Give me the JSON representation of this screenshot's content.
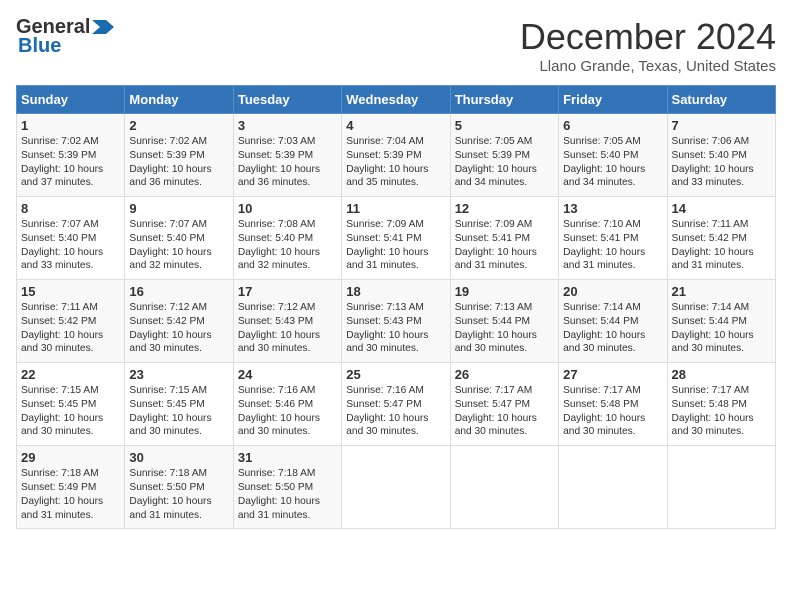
{
  "logo": {
    "part1": "General",
    "part2": "Blue"
  },
  "title": "December 2024",
  "location": "Llano Grande, Texas, United States",
  "days_of_week": [
    "Sunday",
    "Monday",
    "Tuesday",
    "Wednesday",
    "Thursday",
    "Friday",
    "Saturday"
  ],
  "weeks": [
    [
      {
        "day": "1",
        "lines": [
          "Sunrise: 7:02 AM",
          "Sunset: 5:39 PM",
          "Daylight: 10 hours",
          "and 37 minutes."
        ]
      },
      {
        "day": "2",
        "lines": [
          "Sunrise: 7:02 AM",
          "Sunset: 5:39 PM",
          "Daylight: 10 hours",
          "and 36 minutes."
        ]
      },
      {
        "day": "3",
        "lines": [
          "Sunrise: 7:03 AM",
          "Sunset: 5:39 PM",
          "Daylight: 10 hours",
          "and 36 minutes."
        ]
      },
      {
        "day": "4",
        "lines": [
          "Sunrise: 7:04 AM",
          "Sunset: 5:39 PM",
          "Daylight: 10 hours",
          "and 35 minutes."
        ]
      },
      {
        "day": "5",
        "lines": [
          "Sunrise: 7:05 AM",
          "Sunset: 5:39 PM",
          "Daylight: 10 hours",
          "and 34 minutes."
        ]
      },
      {
        "day": "6",
        "lines": [
          "Sunrise: 7:05 AM",
          "Sunset: 5:40 PM",
          "Daylight: 10 hours",
          "and 34 minutes."
        ]
      },
      {
        "day": "7",
        "lines": [
          "Sunrise: 7:06 AM",
          "Sunset: 5:40 PM",
          "Daylight: 10 hours",
          "and 33 minutes."
        ]
      }
    ],
    [
      {
        "day": "8",
        "lines": [
          "Sunrise: 7:07 AM",
          "Sunset: 5:40 PM",
          "Daylight: 10 hours",
          "and 33 minutes."
        ]
      },
      {
        "day": "9",
        "lines": [
          "Sunrise: 7:07 AM",
          "Sunset: 5:40 PM",
          "Daylight: 10 hours",
          "and 32 minutes."
        ]
      },
      {
        "day": "10",
        "lines": [
          "Sunrise: 7:08 AM",
          "Sunset: 5:40 PM",
          "Daylight: 10 hours",
          "and 32 minutes."
        ]
      },
      {
        "day": "11",
        "lines": [
          "Sunrise: 7:09 AM",
          "Sunset: 5:41 PM",
          "Daylight: 10 hours",
          "and 31 minutes."
        ]
      },
      {
        "day": "12",
        "lines": [
          "Sunrise: 7:09 AM",
          "Sunset: 5:41 PM",
          "Daylight: 10 hours",
          "and 31 minutes."
        ]
      },
      {
        "day": "13",
        "lines": [
          "Sunrise: 7:10 AM",
          "Sunset: 5:41 PM",
          "Daylight: 10 hours",
          "and 31 minutes."
        ]
      },
      {
        "day": "14",
        "lines": [
          "Sunrise: 7:11 AM",
          "Sunset: 5:42 PM",
          "Daylight: 10 hours",
          "and 31 minutes."
        ]
      }
    ],
    [
      {
        "day": "15",
        "lines": [
          "Sunrise: 7:11 AM",
          "Sunset: 5:42 PM",
          "Daylight: 10 hours",
          "and 30 minutes."
        ]
      },
      {
        "day": "16",
        "lines": [
          "Sunrise: 7:12 AM",
          "Sunset: 5:42 PM",
          "Daylight: 10 hours",
          "and 30 minutes."
        ]
      },
      {
        "day": "17",
        "lines": [
          "Sunrise: 7:12 AM",
          "Sunset: 5:43 PM",
          "Daylight: 10 hours",
          "and 30 minutes."
        ]
      },
      {
        "day": "18",
        "lines": [
          "Sunrise: 7:13 AM",
          "Sunset: 5:43 PM",
          "Daylight: 10 hours",
          "and 30 minutes."
        ]
      },
      {
        "day": "19",
        "lines": [
          "Sunrise: 7:13 AM",
          "Sunset: 5:44 PM",
          "Daylight: 10 hours",
          "and 30 minutes."
        ]
      },
      {
        "day": "20",
        "lines": [
          "Sunrise: 7:14 AM",
          "Sunset: 5:44 PM",
          "Daylight: 10 hours",
          "and 30 minutes."
        ]
      },
      {
        "day": "21",
        "lines": [
          "Sunrise: 7:14 AM",
          "Sunset: 5:44 PM",
          "Daylight: 10 hours",
          "and 30 minutes."
        ]
      }
    ],
    [
      {
        "day": "22",
        "lines": [
          "Sunrise: 7:15 AM",
          "Sunset: 5:45 PM",
          "Daylight: 10 hours",
          "and 30 minutes."
        ]
      },
      {
        "day": "23",
        "lines": [
          "Sunrise: 7:15 AM",
          "Sunset: 5:45 PM",
          "Daylight: 10 hours",
          "and 30 minutes."
        ]
      },
      {
        "day": "24",
        "lines": [
          "Sunrise: 7:16 AM",
          "Sunset: 5:46 PM",
          "Daylight: 10 hours",
          "and 30 minutes."
        ]
      },
      {
        "day": "25",
        "lines": [
          "Sunrise: 7:16 AM",
          "Sunset: 5:47 PM",
          "Daylight: 10 hours",
          "and 30 minutes."
        ]
      },
      {
        "day": "26",
        "lines": [
          "Sunrise: 7:17 AM",
          "Sunset: 5:47 PM",
          "Daylight: 10 hours",
          "and 30 minutes."
        ]
      },
      {
        "day": "27",
        "lines": [
          "Sunrise: 7:17 AM",
          "Sunset: 5:48 PM",
          "Daylight: 10 hours",
          "and 30 minutes."
        ]
      },
      {
        "day": "28",
        "lines": [
          "Sunrise: 7:17 AM",
          "Sunset: 5:48 PM",
          "Daylight: 10 hours",
          "and 30 minutes."
        ]
      }
    ],
    [
      {
        "day": "29",
        "lines": [
          "Sunrise: 7:18 AM",
          "Sunset: 5:49 PM",
          "Daylight: 10 hours",
          "and 31 minutes."
        ]
      },
      {
        "day": "30",
        "lines": [
          "Sunrise: 7:18 AM",
          "Sunset: 5:50 PM",
          "Daylight: 10 hours",
          "and 31 minutes."
        ]
      },
      {
        "day": "31",
        "lines": [
          "Sunrise: 7:18 AM",
          "Sunset: 5:50 PM",
          "Daylight: 10 hours",
          "and 31 minutes."
        ]
      },
      null,
      null,
      null,
      null
    ]
  ]
}
